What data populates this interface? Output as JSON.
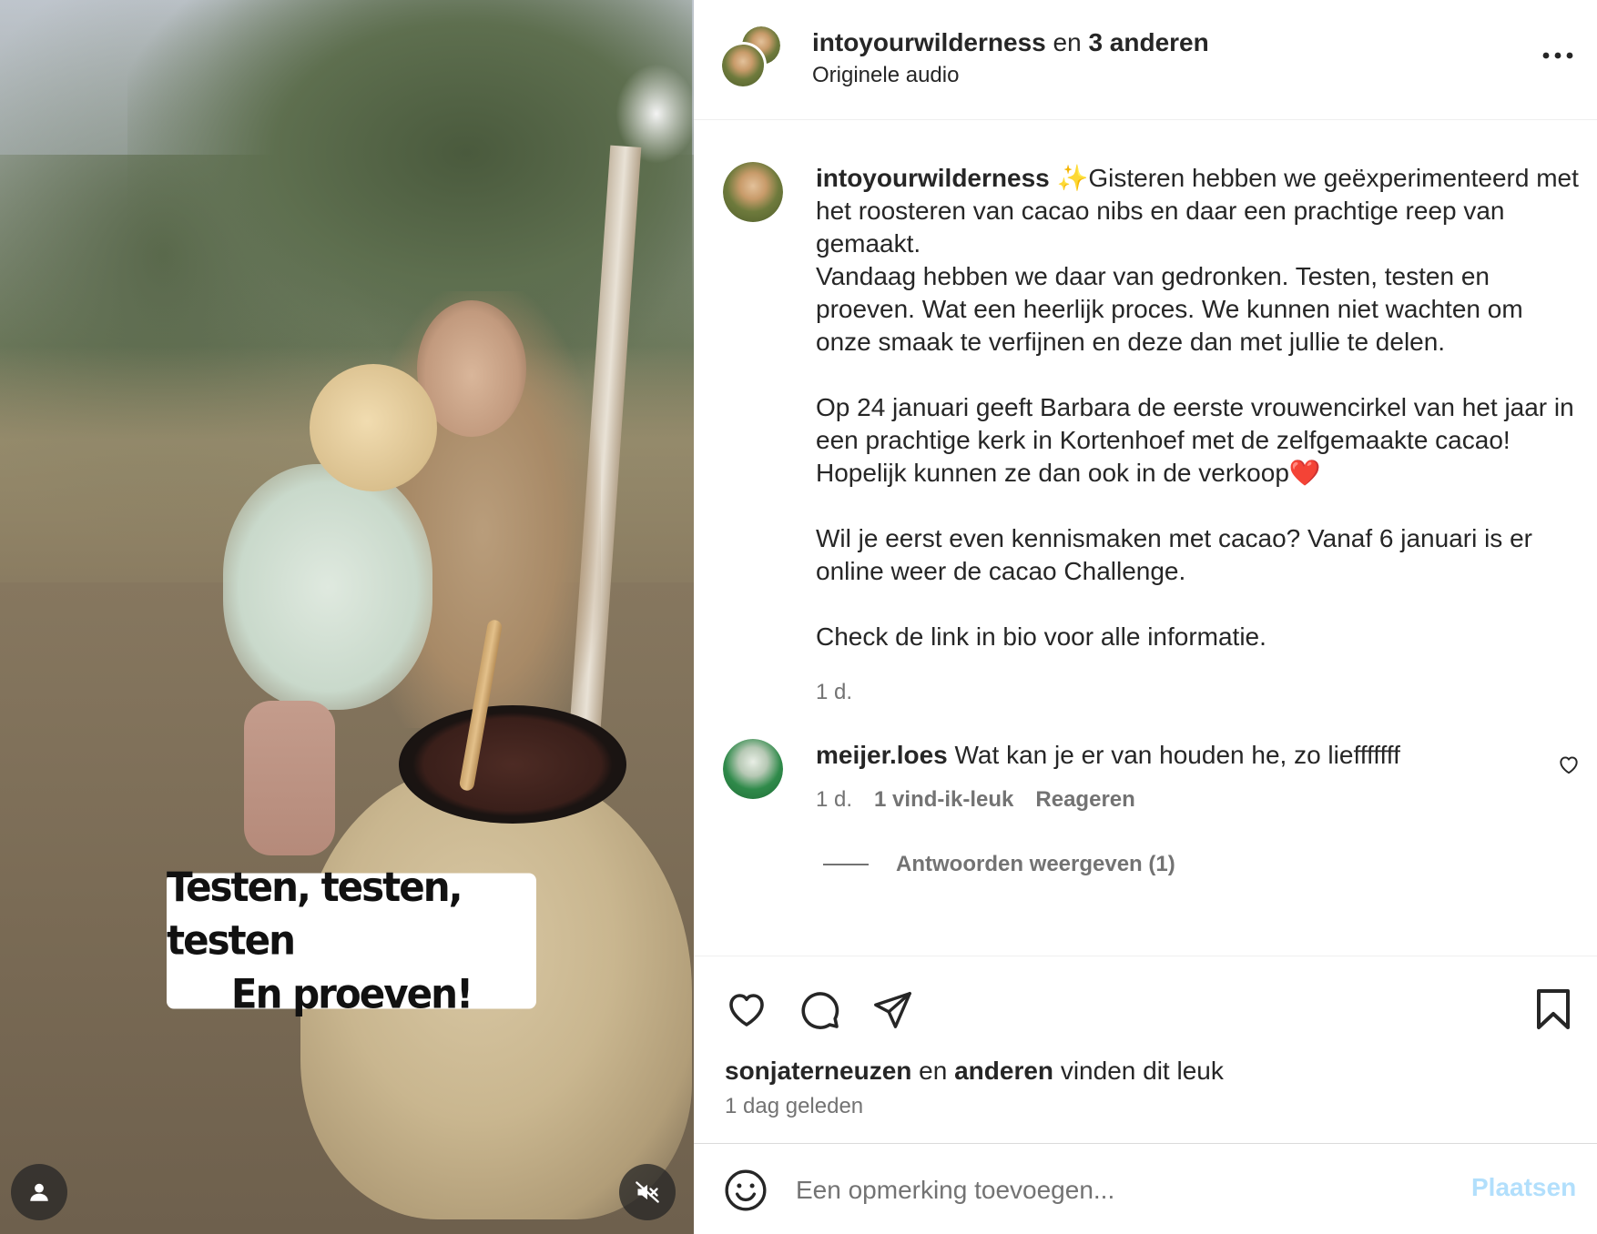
{
  "media": {
    "overlay_caption": [
      "Testen, testen, testen",
      "En proeven!"
    ],
    "tag_button_icon": "user-icon",
    "mute_button_icon": "speaker-muted-icon"
  },
  "header": {
    "username": "intoyourwilderness",
    "connector": "en",
    "others": "3 anderen",
    "subtitle": "Originele audio",
    "more_icon": "more-horizontal-icon"
  },
  "caption": {
    "username": "intoyourwilderness",
    "paragraphs": [
      "✨Gisteren hebben we geëxperimenteerd met het roosteren van cacao nibs en daar een prachtige reep van gemaakt.",
      "Vandaag hebben we daar van gedronken. Testen, testen en proeven. Wat een heerlijk proces. We kunnen niet wachten om onze smaak te verfijnen en deze dan met jullie te delen.",
      "Op 24 januari geeft Barbara de eerste vrouwencirkel van het jaar in een prachtige kerk in Kortenhoef met de zelfgemaakte cacao! Hopelijk kunnen ze dan ook in de verkoop❤️",
      "Wil je eerst even kennismaken met cacao? Vanaf 6 januari is er online weer de cacao Challenge.",
      "Check de link in bio voor alle informatie."
    ],
    "time": "1 d."
  },
  "comments": [
    {
      "username": "meijer.loes",
      "text": "Wat kan je er van houden he, zo liefffffff",
      "time": "1 d.",
      "likes": "1 vind-ik-leuk",
      "reply": "Reageren",
      "view_replies": "Antwoorden weergeven (1)"
    }
  ],
  "actions": {
    "like_icon": "heart-icon",
    "comment_icon": "comment-icon",
    "share_icon": "share-icon",
    "save_icon": "bookmark-icon"
  },
  "likes": {
    "user": "sonjaterneuzen",
    "connector": "en",
    "others": "anderen",
    "suffix": "vinden dit leuk"
  },
  "posted": "1 dag geleden",
  "add_comment": {
    "placeholder": "Een opmerking toevoegen...",
    "post_label": "Plaatsen",
    "post_color": "#b2dffc",
    "emoji_icon": "emoji-icon"
  },
  "colors": {
    "text": "#262626",
    "secondary": "#737373",
    "divider": "#efefef",
    "accent_disabled": "#b2dffc"
  }
}
